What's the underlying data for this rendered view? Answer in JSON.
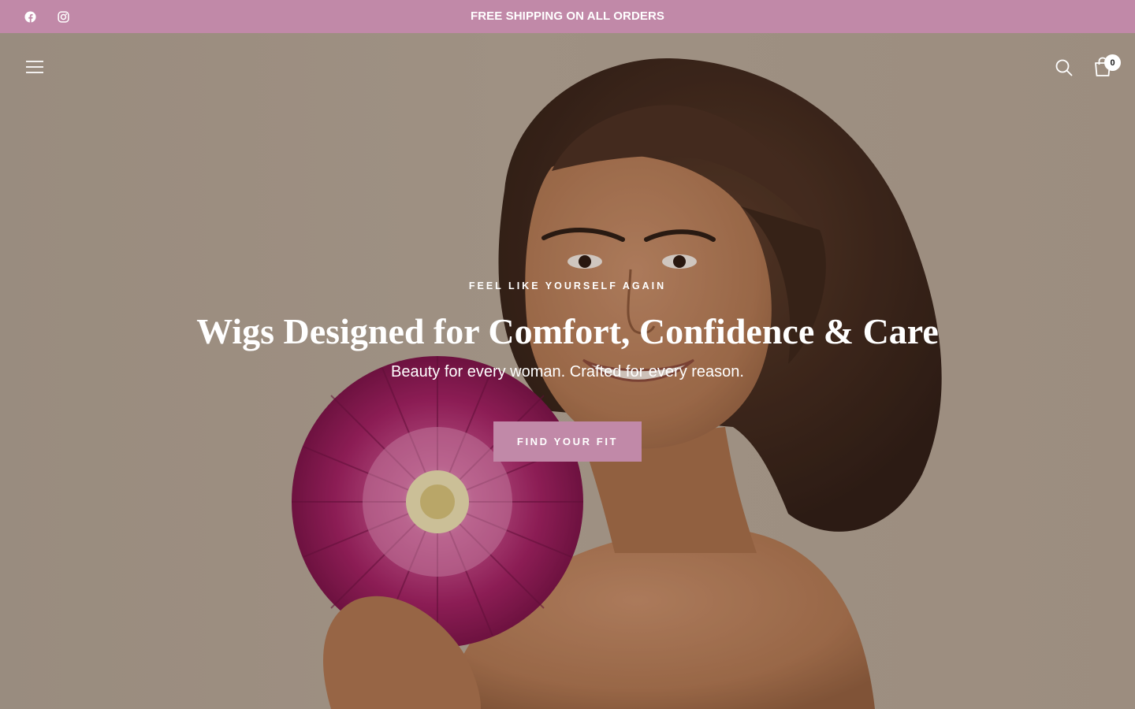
{
  "announcement": {
    "text": "FREE SHIPPING ON ALL ORDERS",
    "background": "#c189a8",
    "socials": [
      {
        "icon": "facebook-icon"
      },
      {
        "icon": "instagram-icon"
      }
    ]
  },
  "header": {
    "menu_icon": "hamburger-menu-icon",
    "search_icon": "search-icon",
    "cart_icon": "shopping-bag-icon",
    "cart_count": "0"
  },
  "hero": {
    "eyebrow": "FEEL LIKE YOURSELF AGAIN",
    "title": "Wigs Designed for Comfort, Confidence & Care",
    "subtitle": "Beauty for every woman. Crafted for every reason.",
    "cta_label": "FIND YOUR FIT",
    "cta_color": "#c189a8"
  }
}
